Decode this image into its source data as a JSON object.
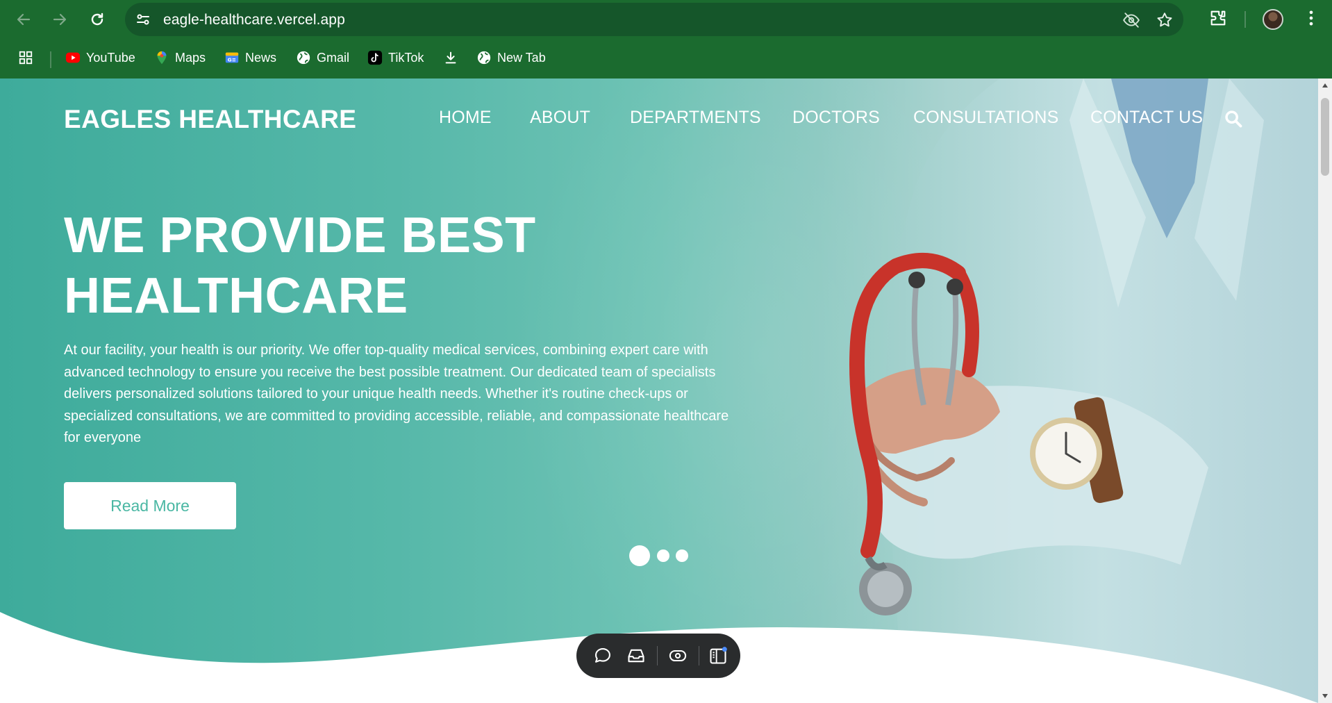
{
  "browser": {
    "url": "eagle-healthcare.vercel.app",
    "bookmarks": [
      {
        "label": "YouTube",
        "icon": "youtube-icon"
      },
      {
        "label": "Maps",
        "icon": "maps-icon"
      },
      {
        "label": "News",
        "icon": "news-icon"
      },
      {
        "label": "Gmail",
        "icon": "globe-icon"
      },
      {
        "label": "TikTok",
        "icon": "tiktok-icon"
      },
      {
        "label": "",
        "icon": "download-icon"
      },
      {
        "label": "New Tab",
        "icon": "globe-icon"
      }
    ]
  },
  "site": {
    "brand": "EAGLES HEALTHCARE",
    "nav": [
      "HOME",
      "ABOUT",
      "DEPARTMENTS",
      "DOCTORS",
      "CONSULTATIONS",
      "CONTACT US"
    ],
    "hero": {
      "title_line1": "WE PROVIDE BEST",
      "title_line2": "HEALTHCARE",
      "description": "At our facility, your health is our priority. We offer top-quality medical services, combining expert care with advanced technology to ensure you receive the best possible treatment. Our dedicated team of specialists delivers personalized solutions tailored to your unique health needs. Whether it's routine check-ups or specialized consultations, we are committed to providing accessible, reliable, and compassionate healthcare for everyone",
      "cta": "Read More"
    },
    "slider": {
      "slides": 3,
      "active": 1
    }
  },
  "colors": {
    "chrome": "#1b6b2f",
    "hero_teal": "#4ab7a3",
    "text_on_hero": "#ffffff"
  }
}
